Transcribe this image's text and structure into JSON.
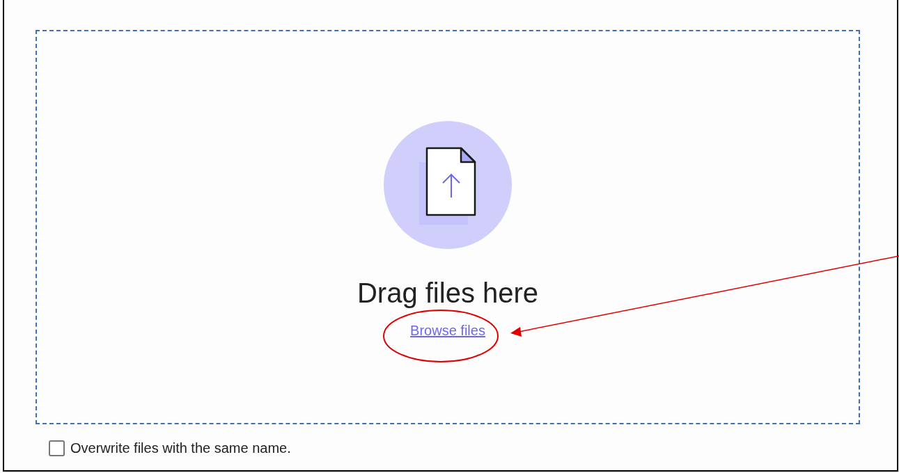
{
  "dropzone": {
    "title": "Drag files here",
    "browse_link": "Browse files"
  },
  "overwrite_option": {
    "label": "Overwrite files with the same name.",
    "checked": false
  },
  "annotation": {
    "kind": "callout"
  }
}
